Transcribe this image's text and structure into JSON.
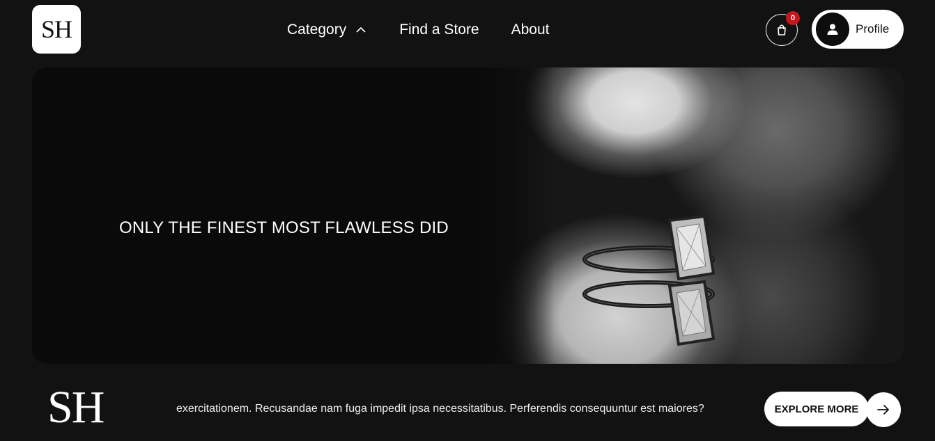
{
  "header": {
    "logo_text": "SH",
    "nav": [
      {
        "label": "Category",
        "icon": "chevron-up-icon"
      },
      {
        "label": "Find a Store"
      },
      {
        "label": "About"
      }
    ],
    "cart": {
      "icon": "shopping-bag-icon",
      "count": "0",
      "badge_color": "#c8161c"
    },
    "profile": {
      "label": "Profile",
      "icon": "user-icon"
    }
  },
  "hero": {
    "title": "ONLY THE FINEST MOST FLAWLESS DID",
    "image": "ring-photo"
  },
  "footer": {
    "logo_text": "SH",
    "text": "exercitationem. Recusandae nam fuga impedit ipsa necessitatibus. Perferendis consequuntur est maiores?",
    "explore_label": "EXPLORE MORE",
    "arrow_icon": "arrow-right-icon"
  },
  "colors": {
    "background": "#121212",
    "hero_bg": "#0a0a0b",
    "accent": "#ffffff"
  }
}
